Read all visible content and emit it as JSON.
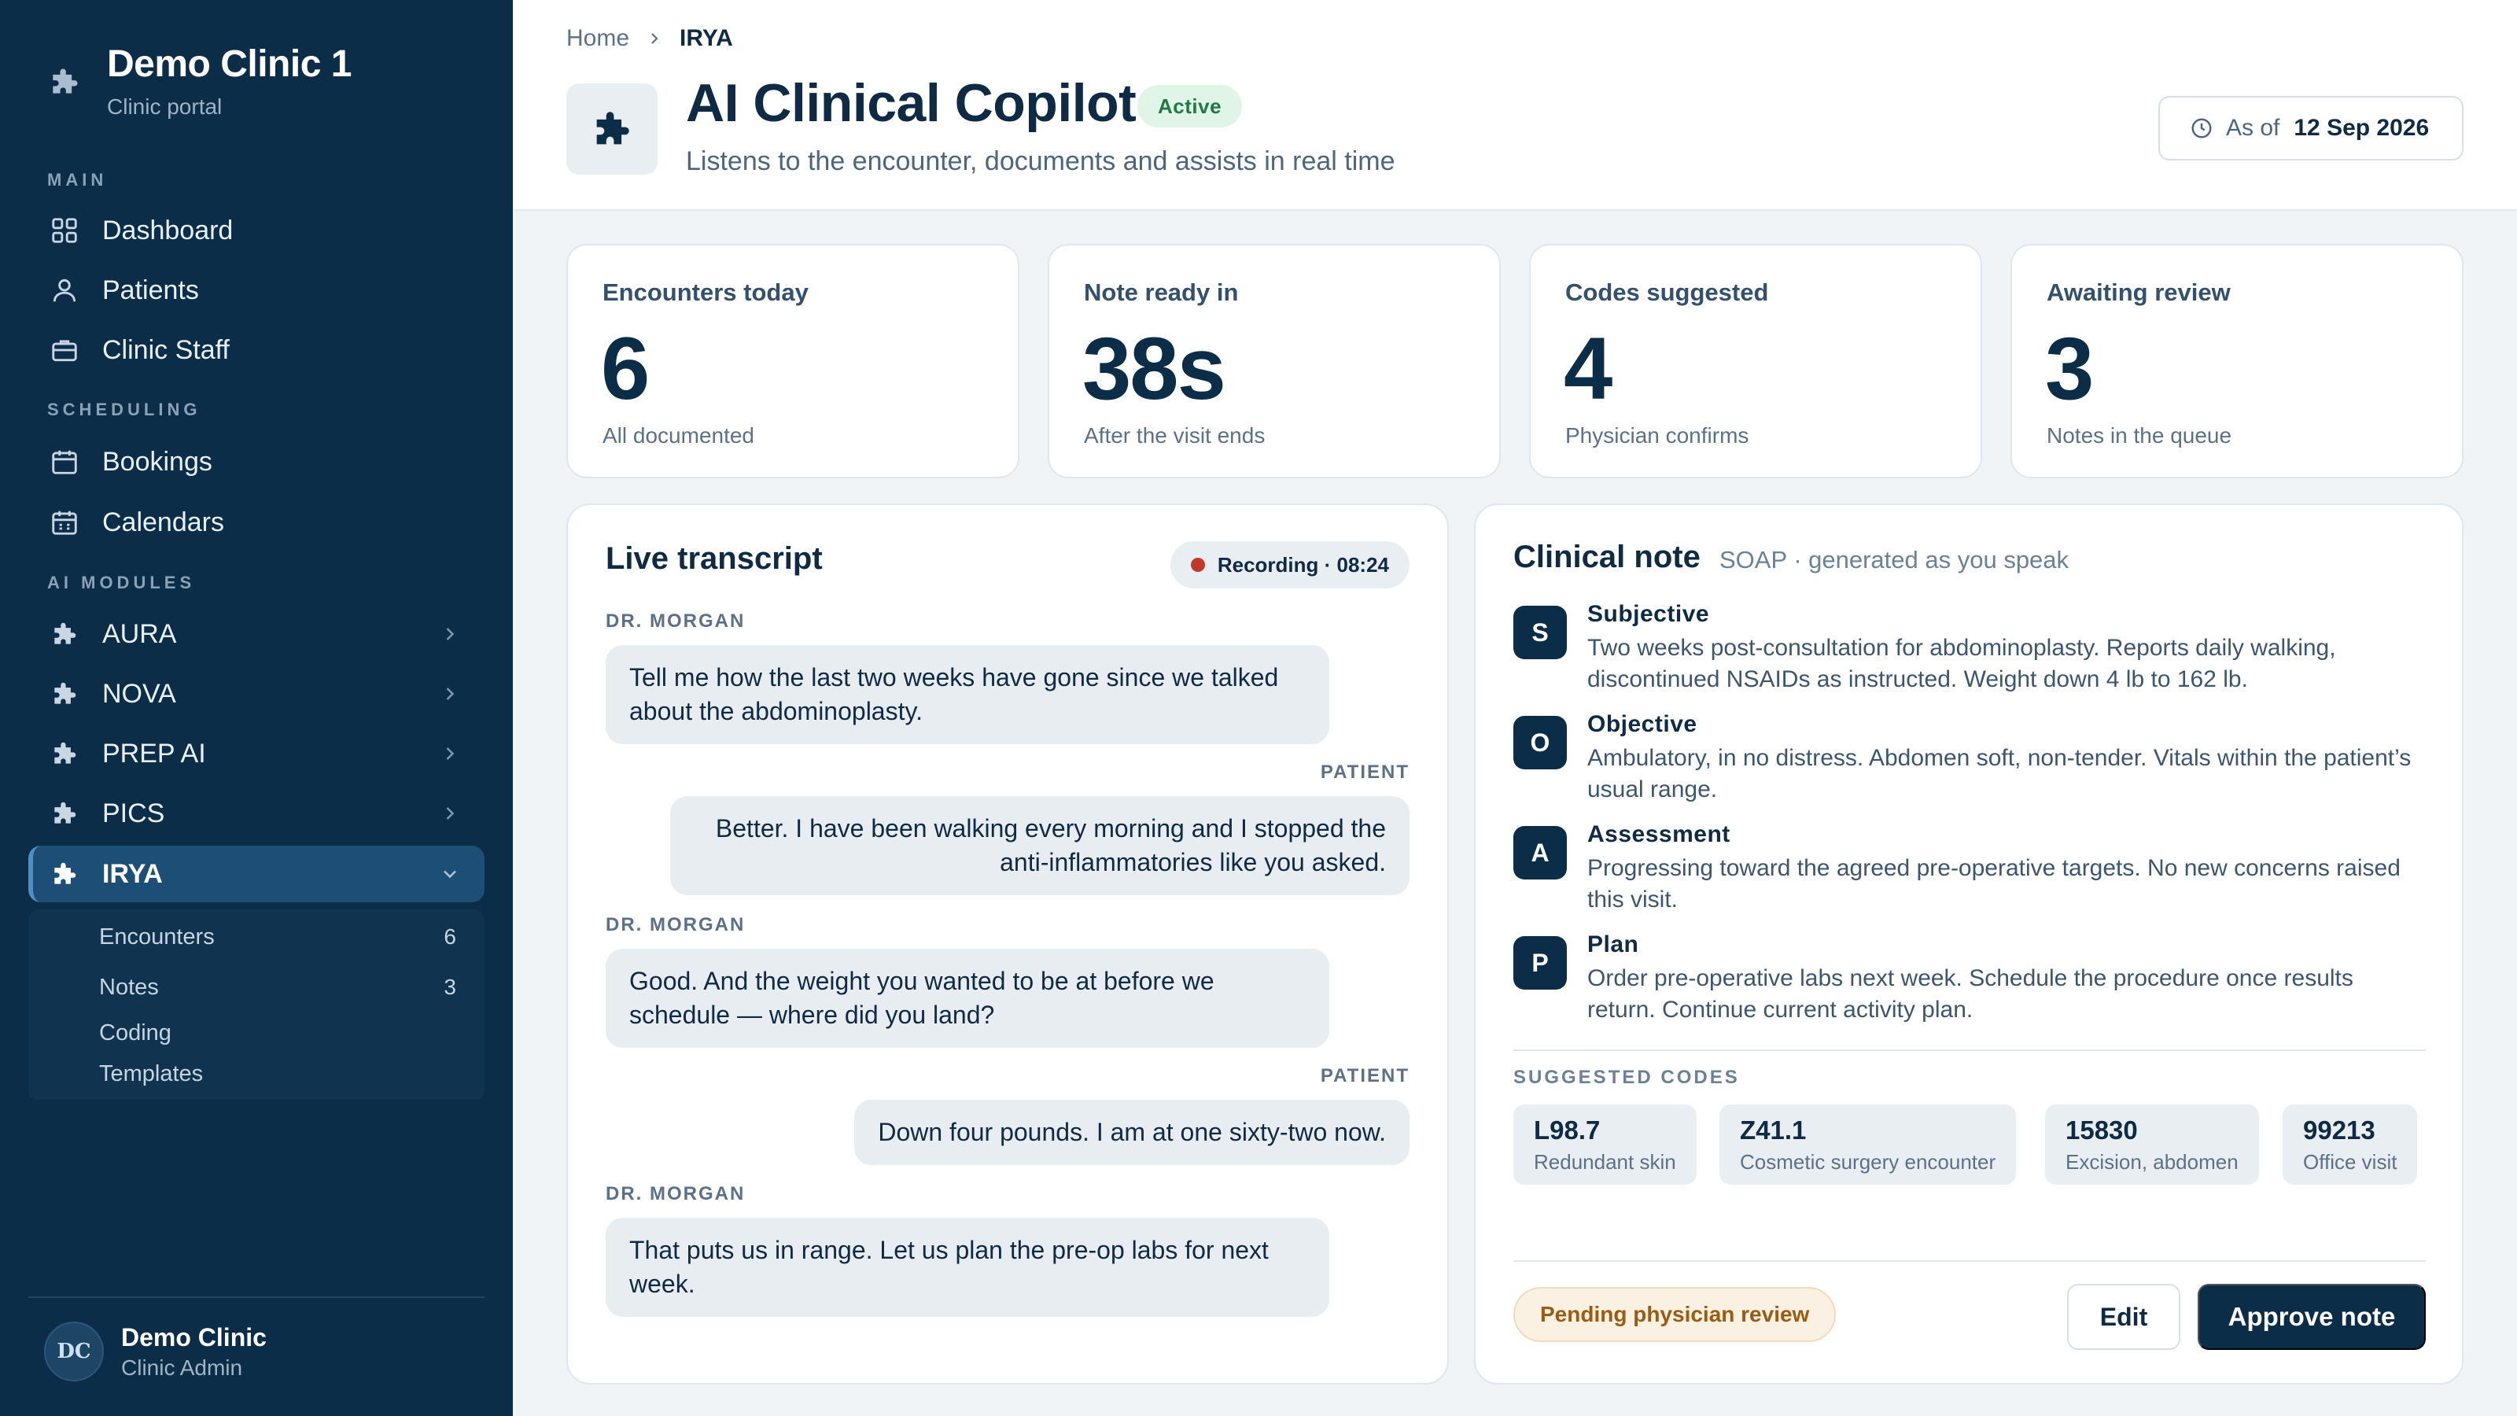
{
  "sidebar": {
    "brand": {
      "title": "Demo Clinic 1",
      "subtitle": "Clinic portal"
    },
    "sections": {
      "main": "MAIN",
      "scheduling": "SCHEDULING",
      "ai_modules": "AI MODULES"
    },
    "items": {
      "dashboard": "Dashboard",
      "patients": "Patients",
      "clinic_staff": "Clinic Staff",
      "bookings": "Bookings",
      "calendars": "Calendars",
      "aura": "AURA",
      "nova": "NOVA",
      "prep_ai": "PREP AI",
      "pics": "PICS",
      "irya": "IRYA"
    },
    "submenu": {
      "encounters": {
        "label": "Encounters",
        "count": "6"
      },
      "notes": {
        "label": "Notes",
        "count": "3"
      },
      "coding": {
        "label": "Coding"
      },
      "templates": {
        "label": "Templates"
      }
    },
    "user": {
      "initials": "DC",
      "name": "Demo Clinic",
      "role": "Clinic Admin"
    }
  },
  "header": {
    "breadcrumb": {
      "home": "Home",
      "current": "IRYA"
    },
    "title": "AI Clinical Copilot",
    "status": "Active",
    "subtitle": "Listens to the encounter, documents and assists in real time",
    "as_of_label": "As of",
    "as_of_date": "12 Sep 2026"
  },
  "stats": [
    {
      "label": "Encounters today",
      "value": "6",
      "note": "All documented"
    },
    {
      "label": "Note ready in",
      "value": "38s",
      "note": "After the visit ends"
    },
    {
      "label": "Codes suggested",
      "value": "4",
      "note": "Physician confirms"
    },
    {
      "label": "Awaiting review",
      "value": "3",
      "note": "Notes in the queue"
    }
  ],
  "transcript": {
    "title": "Live transcript",
    "recording": "Recording · 08:24",
    "messages": [
      {
        "speaker": "DR. MORGAN",
        "text": "Tell me how the last two weeks have gone since we talked about the abdominoplasty."
      },
      {
        "speaker": "PATIENT",
        "text": "Better. I have been walking every morning and I stopped the anti-inflammatories like you asked."
      },
      {
        "speaker": "DR. MORGAN",
        "text": "Good. And the weight you wanted to be at before we schedule — where did you land?"
      },
      {
        "speaker": "PATIENT",
        "text": "Down four pounds. I am at one sixty-two now."
      },
      {
        "speaker": "DR. MORGAN",
        "text": "That puts us in range. Let us plan the pre-op labs for next week."
      }
    ]
  },
  "note": {
    "title": "Clinical note",
    "subtitle": "SOAP · generated as you speak",
    "soap": [
      {
        "letter": "S",
        "heading": "Subjective",
        "text": "Two weeks post-consultation for abdominoplasty. Reports daily walking, discontinued NSAIDs as instructed. Weight down 4 lb to 162 lb."
      },
      {
        "letter": "O",
        "heading": "Objective",
        "text": "Ambulatory, in no distress. Abdomen soft, non-tender. Vitals within the patient’s usual range."
      },
      {
        "letter": "A",
        "heading": "Assessment",
        "text": "Progressing toward the agreed pre-operative targets. No new concerns raised this visit."
      },
      {
        "letter": "P",
        "heading": "Plan",
        "text": "Order pre-operative labs next week. Schedule the procedure once results return. Continue current activity plan."
      }
    ],
    "codes_label": "SUGGESTED CODES",
    "codes": [
      {
        "code": "L98.7",
        "desc": "Redundant skin"
      },
      {
        "code": "Z41.1",
        "desc": "Cosmetic surgery encounter"
      },
      {
        "code": "15830",
        "desc": "Excision, abdomen"
      },
      {
        "code": "99213",
        "desc": "Office visit"
      }
    ],
    "review_status": "Pending physician review",
    "edit_label": "Edit",
    "approve_label": "Approve note"
  },
  "colors": {
    "sidebar_bg": "#0c2d48",
    "active_nav": "#1d4e75",
    "primary": "#0c2d48",
    "status_active": "#1f7a44",
    "recording_dot": "#c0392b",
    "pending": "#9a5b12"
  },
  "icons": {
    "brand": "puzzle-icon",
    "dashboard": "grid-icon",
    "patients": "user-icon",
    "clinic_staff": "briefcase-icon",
    "bookings": "calendar-icon",
    "calendars": "calendar-grid-icon",
    "modules": "puzzle-icon",
    "as_of": "clock-icon"
  }
}
